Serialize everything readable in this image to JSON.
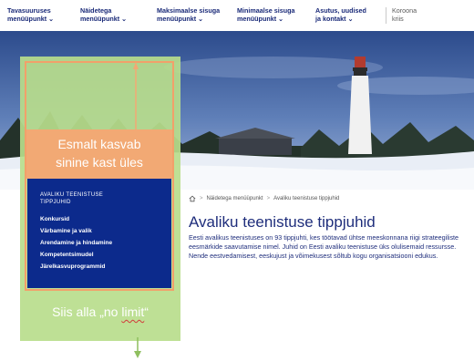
{
  "nav": {
    "items": [
      {
        "line1": "Tavasuuruses",
        "line2": "menüüpunkt"
      },
      {
        "line1": "Näidetega",
        "line2": "menüüpunkt"
      },
      {
        "line1": "Maksimaalse sisuga",
        "line2": "menüüpunkt"
      },
      {
        "line1": "Minimaalse sisuga",
        "line2": "menüüpunkt"
      },
      {
        "line1": "Asutus, uudised",
        "line2": "ja kontakt"
      }
    ],
    "corona": {
      "line1": "Koroona",
      "line2": "kriis"
    }
  },
  "annotations": {
    "top_line1": "Esmalt kasvab",
    "top_line2": "sinine kast üles",
    "bottom_prefix": "Siis alla „no ",
    "bottom_word": "limit",
    "bottom_suffix": "“"
  },
  "sidenav": {
    "heading_line1": "AVALIKU TEENISTUSE",
    "heading_line2": "TIPPJUHID",
    "items": [
      "Konkursid",
      "Värbamine ja valik",
      "Arendamine ja hindamine",
      "Kompetentsimudel",
      "Järelkasvuprogrammid"
    ]
  },
  "breadcrumb": {
    "items": [
      "Näidetega menüüpunkt",
      "Avaliku teenistuse tippjuhid"
    ],
    "separator": ">"
  },
  "page": {
    "title": "Avaliku teenistuse tippjuhid",
    "intro": "Eesti avalikus teenistuses on 93 tippjuhti, kes töötavad ühtse meeskonnana riigi strateegiliste eesmärkide saavutamise nimel. Juhid on Eesti avaliku teenistuse üks olulisemaid ressursse. Nende eestvedamisest, eeskujust ja võimekusest sõltub kogu organisatsiooni edukus."
  },
  "colors": {
    "brand_blue": "#1f2e7c",
    "nav_box": "#0c2a8c",
    "green_overlay": "#b9dd8c",
    "orange_accent": "#f2a974"
  },
  "icons": {
    "nav_chevron": "chevron-down-icon",
    "breadcrumb_home": "home-icon"
  }
}
